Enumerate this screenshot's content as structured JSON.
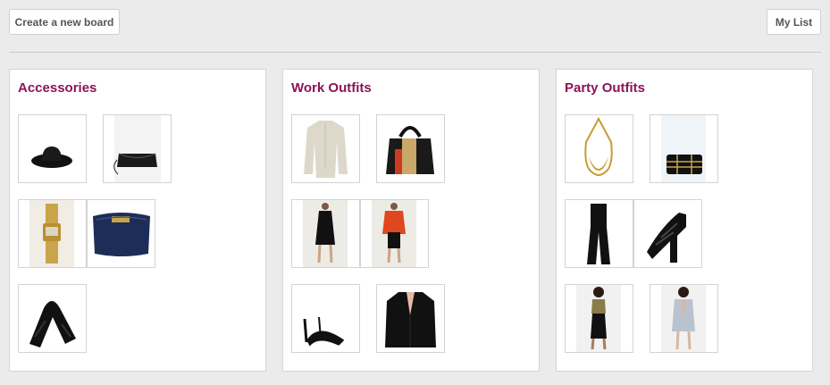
{
  "toolbar": {
    "create_label": "Create a new board",
    "mylist_label": "My List"
  },
  "boards": [
    {
      "title": "Accessories",
      "items": [
        "black-floppy-hat",
        "black-clutch-bag",
        "gold-digital-watch",
        "navy-cosmetic-bag",
        "black-fur-scarf"
      ]
    },
    {
      "title": "Work Outfits",
      "items": [
        "cream-silk-blouse",
        "black-tote-bag",
        "black-shift-dress",
        "red-blazer-outfit",
        "black-pointed-heels",
        "black-tailored-blazer"
      ]
    },
    {
      "title": "Party Outfits",
      "items": [
        "gold-collar-necklace",
        "black-box-clutch",
        "black-strapless-jumpsuit",
        "black-platform-sandals",
        "black-crop-top-outfit",
        "grey-plunge-playsuit"
      ]
    }
  ]
}
